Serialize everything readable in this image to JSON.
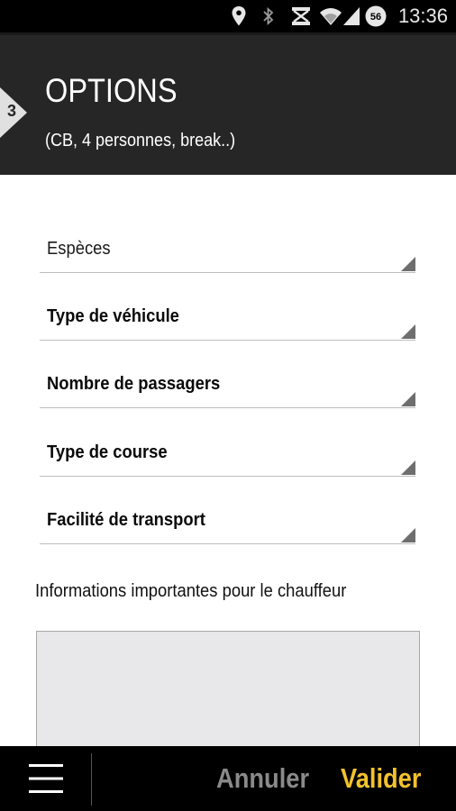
{
  "status_bar": {
    "time": "13:36",
    "battery_level": "56",
    "icons": [
      "location-icon",
      "bluetooth-icon",
      "vibrate-icon",
      "wifi-icon",
      "signal-icon",
      "battery-icon"
    ]
  },
  "header": {
    "step_number": "3",
    "title": "OPTIONS",
    "subtitle": "(CB, 4 personnes, break..)"
  },
  "form": {
    "fields": [
      {
        "label": "Espèces",
        "state": "selected-value"
      },
      {
        "label": "Type de véhicule",
        "state": "placeholder"
      },
      {
        "label": "Nombre de passagers",
        "state": "placeholder"
      },
      {
        "label": "Type de course",
        "state": "placeholder"
      },
      {
        "label": "Facilité de transport",
        "state": "placeholder"
      }
    ],
    "notes_label": "Informations importantes pour le chauffeur",
    "notes_value": ""
  },
  "bottom_bar": {
    "cancel_label": "Annuler",
    "validate_label": "Valider"
  },
  "colors": {
    "header_bg": "#262626",
    "accent": "#f2c12e",
    "cancel_text": "#8a8a8a",
    "notes_bg": "#e8e8ea"
  }
}
